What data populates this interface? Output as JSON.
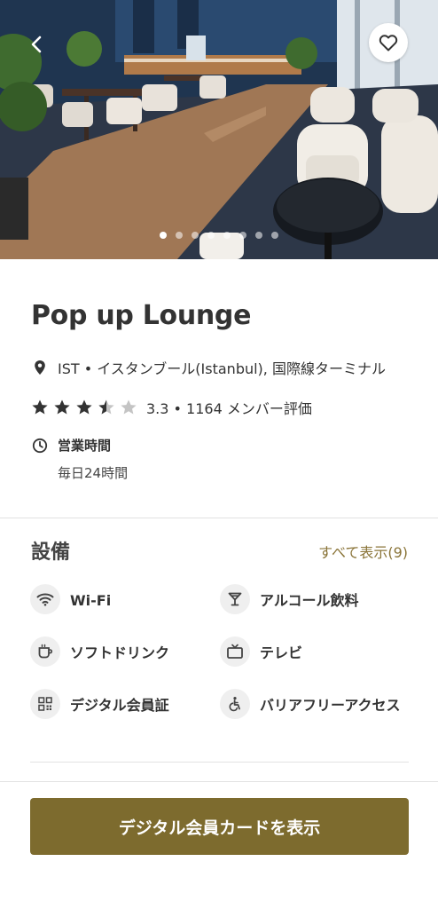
{
  "hero": {
    "image_alt": "Lounge interior photo",
    "slide_count": 8,
    "active_slide": 1,
    "back_icon": "chevron-left-icon",
    "favorite_icon": "heart-outline-icon"
  },
  "lounge": {
    "name": "Pop up Lounge",
    "location": "IST • イスタンブール(Istanbul), 国際線ターミナル",
    "rating_value": 3.3,
    "rating_text": "3.3 • 1164 メンバー評価",
    "hours_label": "営業時間",
    "hours_value": "毎日24時間"
  },
  "facilities": {
    "title": "設備",
    "show_all": "すべて表示(9)",
    "items": [
      {
        "label": "Wi-Fi",
        "icon": "wifi-icon"
      },
      {
        "label": "アルコール飲料",
        "icon": "cocktail-icon"
      },
      {
        "label": "ソフトドリンク",
        "icon": "cup-icon"
      },
      {
        "label": "テレビ",
        "icon": "tv-icon"
      },
      {
        "label": "デジタル会員証",
        "icon": "qr-code-icon"
      },
      {
        "label": "バリアフリーアクセス",
        "icon": "wheelchair-icon"
      }
    ]
  },
  "cta": {
    "label": "デジタル会員カードを表示"
  },
  "colors": {
    "accent": "#7d6b2e",
    "link": "#8a7438",
    "star_filled": "#333333",
    "star_empty": "#c4c4c4"
  }
}
